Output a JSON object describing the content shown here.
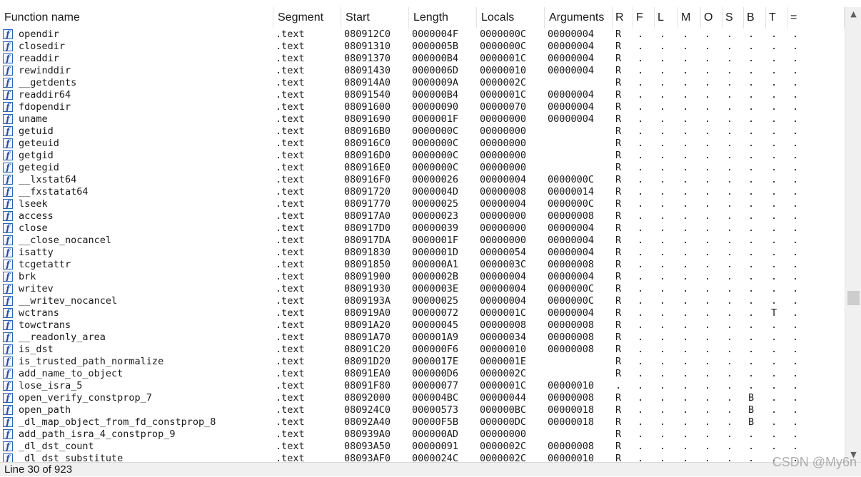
{
  "columns": [
    "Function name",
    "Segment",
    "Start",
    "Length",
    "Locals",
    "Arguments",
    "R",
    "F",
    "L",
    "M",
    "O",
    "S",
    "B",
    "T",
    "="
  ],
  "rows": [
    {
      "name": "opendir",
      "seg": ".text",
      "start": "080912C0",
      "len": "0000004F",
      "locals": "0000000C",
      "args": "00000004",
      "r": "R",
      "f": ".",
      "l": ".",
      "m": ".",
      "o": ".",
      "s": ".",
      "b": ".",
      "t": ".",
      "eq": "."
    },
    {
      "name": "closedir",
      "seg": ".text",
      "start": "08091310",
      "len": "0000005B",
      "locals": "0000000C",
      "args": "00000004",
      "r": "R",
      "f": ".",
      "l": ".",
      "m": ".",
      "o": ".",
      "s": ".",
      "b": ".",
      "t": ".",
      "eq": "."
    },
    {
      "name": "readdir",
      "seg": ".text",
      "start": "08091370",
      "len": "000000B4",
      "locals": "0000001C",
      "args": "00000004",
      "r": "R",
      "f": ".",
      "l": ".",
      "m": ".",
      "o": ".",
      "s": ".",
      "b": ".",
      "t": ".",
      "eq": "."
    },
    {
      "name": "rewinddir",
      "seg": ".text",
      "start": "08091430",
      "len": "0000006D",
      "locals": "00000010",
      "args": "00000004",
      "r": "R",
      "f": ".",
      "l": ".",
      "m": ".",
      "o": ".",
      "s": ".",
      "b": ".",
      "t": ".",
      "eq": "."
    },
    {
      "name": "__getdents",
      "seg": ".text",
      "start": "080914A0",
      "len": "0000009A",
      "locals": "0000002C",
      "args": "",
      "r": "R",
      "f": ".",
      "l": ".",
      "m": ".",
      "o": ".",
      "s": ".",
      "b": ".",
      "t": ".",
      "eq": "."
    },
    {
      "name": "readdir64",
      "seg": ".text",
      "start": "08091540",
      "len": "000000B4",
      "locals": "0000001C",
      "args": "00000004",
      "r": "R",
      "f": ".",
      "l": ".",
      "m": ".",
      "o": ".",
      "s": ".",
      "b": ".",
      "t": ".",
      "eq": "."
    },
    {
      "name": "fdopendir",
      "seg": ".text",
      "start": "08091600",
      "len": "00000090",
      "locals": "00000070",
      "args": "00000004",
      "r": "R",
      "f": ".",
      "l": ".",
      "m": ".",
      "o": ".",
      "s": ".",
      "b": ".",
      "t": ".",
      "eq": "."
    },
    {
      "name": "uname",
      "seg": ".text",
      "start": "08091690",
      "len": "0000001F",
      "locals": "00000000",
      "args": "00000004",
      "r": "R",
      "f": ".",
      "l": ".",
      "m": ".",
      "o": ".",
      "s": ".",
      "b": ".",
      "t": ".",
      "eq": "."
    },
    {
      "name": "getuid",
      "seg": ".text",
      "start": "080916B0",
      "len": "0000000C",
      "locals": "00000000",
      "args": "",
      "r": "R",
      "f": ".",
      "l": ".",
      "m": ".",
      "o": ".",
      "s": ".",
      "b": ".",
      "t": ".",
      "eq": "."
    },
    {
      "name": "geteuid",
      "seg": ".text",
      "start": "080916C0",
      "len": "0000000C",
      "locals": "00000000",
      "args": "",
      "r": "R",
      "f": ".",
      "l": ".",
      "m": ".",
      "o": ".",
      "s": ".",
      "b": ".",
      "t": ".",
      "eq": "."
    },
    {
      "name": "getgid",
      "seg": ".text",
      "start": "080916D0",
      "len": "0000000C",
      "locals": "00000000",
      "args": "",
      "r": "R",
      "f": ".",
      "l": ".",
      "m": ".",
      "o": ".",
      "s": ".",
      "b": ".",
      "t": ".",
      "eq": "."
    },
    {
      "name": "getegid",
      "seg": ".text",
      "start": "080916E0",
      "len": "0000000C",
      "locals": "00000000",
      "args": "",
      "r": "R",
      "f": ".",
      "l": ".",
      "m": ".",
      "o": ".",
      "s": ".",
      "b": ".",
      "t": ".",
      "eq": "."
    },
    {
      "name": "__lxstat64",
      "seg": ".text",
      "start": "080916F0",
      "len": "00000026",
      "locals": "00000004",
      "args": "0000000C",
      "r": "R",
      "f": ".",
      "l": ".",
      "m": ".",
      "o": ".",
      "s": ".",
      "b": ".",
      "t": ".",
      "eq": "."
    },
    {
      "name": "__fxstatat64",
      "seg": ".text",
      "start": "08091720",
      "len": "0000004D",
      "locals": "00000008",
      "args": "00000014",
      "r": "R",
      "f": ".",
      "l": ".",
      "m": ".",
      "o": ".",
      "s": ".",
      "b": ".",
      "t": ".",
      "eq": "."
    },
    {
      "name": "lseek",
      "seg": ".text",
      "start": "08091770",
      "len": "00000025",
      "locals": "00000004",
      "args": "0000000C",
      "r": "R",
      "f": ".",
      "l": ".",
      "m": ".",
      "o": ".",
      "s": ".",
      "b": ".",
      "t": ".",
      "eq": "."
    },
    {
      "name": "access",
      "seg": ".text",
      "start": "080917A0",
      "len": "00000023",
      "locals": "00000000",
      "args": "00000008",
      "r": "R",
      "f": ".",
      "l": ".",
      "m": ".",
      "o": ".",
      "s": ".",
      "b": ".",
      "t": ".",
      "eq": "."
    },
    {
      "name": "close",
      "seg": ".text",
      "start": "080917D0",
      "len": "00000039",
      "locals": "00000000",
      "args": "00000004",
      "r": "R",
      "f": ".",
      "l": ".",
      "m": ".",
      "o": ".",
      "s": ".",
      "b": ".",
      "t": ".",
      "eq": "."
    },
    {
      "name": "__close_nocancel",
      "seg": ".text",
      "start": "080917DA",
      "len": "0000001F",
      "locals": "00000000",
      "args": "00000004",
      "r": "R",
      "f": ".",
      "l": ".",
      "m": ".",
      "o": ".",
      "s": ".",
      "b": ".",
      "t": ".",
      "eq": "."
    },
    {
      "name": "isatty",
      "seg": ".text",
      "start": "08091830",
      "len": "0000001D",
      "locals": "00000054",
      "args": "00000004",
      "r": "R",
      "f": ".",
      "l": ".",
      "m": ".",
      "o": ".",
      "s": ".",
      "b": ".",
      "t": ".",
      "eq": "."
    },
    {
      "name": "tcgetattr",
      "seg": ".text",
      "start": "08091850",
      "len": "000000A1",
      "locals": "0000003C",
      "args": "00000008",
      "r": "R",
      "f": ".",
      "l": ".",
      "m": ".",
      "o": ".",
      "s": ".",
      "b": ".",
      "t": ".",
      "eq": "."
    },
    {
      "name": "brk",
      "seg": ".text",
      "start": "08091900",
      "len": "0000002B",
      "locals": "00000004",
      "args": "00000004",
      "r": "R",
      "f": ".",
      "l": ".",
      "m": ".",
      "o": ".",
      "s": ".",
      "b": ".",
      "t": ".",
      "eq": "."
    },
    {
      "name": "writev",
      "seg": ".text",
      "start": "08091930",
      "len": "0000003E",
      "locals": "00000004",
      "args": "0000000C",
      "r": "R",
      "f": ".",
      "l": ".",
      "m": ".",
      "o": ".",
      "s": ".",
      "b": ".",
      "t": ".",
      "eq": "."
    },
    {
      "name": "__writev_nocancel",
      "seg": ".text",
      "start": "0809193A",
      "len": "00000025",
      "locals": "00000004",
      "args": "0000000C",
      "r": "R",
      "f": ".",
      "l": ".",
      "m": ".",
      "o": ".",
      "s": ".",
      "b": ".",
      "t": ".",
      "eq": "."
    },
    {
      "name": "wctrans",
      "seg": ".text",
      "start": "080919A0",
      "len": "00000072",
      "locals": "0000001C",
      "args": "00000004",
      "r": "R",
      "f": ".",
      "l": ".",
      "m": ".",
      "o": ".",
      "s": ".",
      "b": ".",
      "t": "T",
      "eq": "."
    },
    {
      "name": "towctrans",
      "seg": ".text",
      "start": "08091A20",
      "len": "00000045",
      "locals": "00000008",
      "args": "00000008",
      "r": "R",
      "f": ".",
      "l": ".",
      "m": ".",
      "o": ".",
      "s": ".",
      "b": ".",
      "t": ".",
      "eq": "."
    },
    {
      "name": "__readonly_area",
      "seg": ".text",
      "start": "08091A70",
      "len": "000001A9",
      "locals": "00000034",
      "args": "00000008",
      "r": "R",
      "f": ".",
      "l": ".",
      "m": ".",
      "o": ".",
      "s": ".",
      "b": ".",
      "t": ".",
      "eq": "."
    },
    {
      "name": "is_dst",
      "seg": ".text",
      "start": "08091C20",
      "len": "000000F6",
      "locals": "00000010",
      "args": "00000008",
      "r": "R",
      "f": ".",
      "l": ".",
      "m": ".",
      "o": ".",
      "s": ".",
      "b": ".",
      "t": ".",
      "eq": "."
    },
    {
      "name": "is_trusted_path_normalize",
      "seg": ".text",
      "start": "08091D20",
      "len": "0000017E",
      "locals": "0000001E",
      "args": "",
      "r": "R",
      "f": ".",
      "l": ".",
      "m": ".",
      "o": ".",
      "s": ".",
      "b": ".",
      "t": ".",
      "eq": "."
    },
    {
      "name": "add_name_to_object",
      "seg": ".text",
      "start": "08091EA0",
      "len": "000000D6",
      "locals": "0000002C",
      "args": "",
      "r": "R",
      "f": ".",
      "l": ".",
      "m": ".",
      "o": ".",
      "s": ".",
      "b": ".",
      "t": ".",
      "eq": "."
    },
    {
      "name": "lose_isra_5",
      "seg": ".text",
      "start": "08091F80",
      "len": "00000077",
      "locals": "0000001C",
      "args": "00000010",
      "r": ".",
      "f": ".",
      "l": ".",
      "m": ".",
      "o": ".",
      "s": ".",
      "b": ".",
      "t": ".",
      "eq": "."
    },
    {
      "name": "open_verify_constprop_7",
      "seg": ".text",
      "start": "08092000",
      "len": "000004BC",
      "locals": "00000044",
      "args": "00000008",
      "r": "R",
      "f": ".",
      "l": ".",
      "m": ".",
      "o": ".",
      "s": ".",
      "b": "B",
      "t": ".",
      "eq": "."
    },
    {
      "name": "open_path",
      "seg": ".text",
      "start": "080924C0",
      "len": "00000573",
      "locals": "000000BC",
      "args": "00000018",
      "r": "R",
      "f": ".",
      "l": ".",
      "m": ".",
      "o": ".",
      "s": ".",
      "b": "B",
      "t": ".",
      "eq": "."
    },
    {
      "name": "_dl_map_object_from_fd_constprop_8",
      "seg": ".text",
      "start": "08092A40",
      "len": "00000F5B",
      "locals": "000000DC",
      "args": "00000018",
      "r": "R",
      "f": ".",
      "l": ".",
      "m": ".",
      "o": ".",
      "s": ".",
      "b": "B",
      "t": ".",
      "eq": "."
    },
    {
      "name": "add_path_isra_4_constprop_9",
      "seg": ".text",
      "start": "080939A0",
      "len": "000000AD",
      "locals": "00000000",
      "args": "",
      "r": "R",
      "f": ".",
      "l": ".",
      "m": ".",
      "o": ".",
      "s": ".",
      "b": ".",
      "t": ".",
      "eq": "."
    },
    {
      "name": "_dl_dst_count",
      "seg": ".text",
      "start": "08093A50",
      "len": "00000091",
      "locals": "0000002C",
      "args": "00000008",
      "r": "R",
      "f": ".",
      "l": ".",
      "m": ".",
      "o": ".",
      "s": ".",
      "b": ".",
      "t": ".",
      "eq": "."
    },
    {
      "name": "_dl_dst_substitute",
      "seg": ".text",
      "start": "08093AF0",
      "len": "0000024C",
      "locals": "0000002C",
      "args": "00000010",
      "r": "R",
      "f": ".",
      "l": ".",
      "m": ".",
      "o": ".",
      "s": ".",
      "b": ".",
      "t": ".",
      "eq": "."
    }
  ],
  "status": "Line 30 of 923",
  "watermark": "CSDN @My6n",
  "icons": {
    "function": "function-icon",
    "scroll_up": "scroll-up-arrow-icon",
    "scroll_down": "scroll-down-arrow-icon"
  },
  "colors": {
    "icon_border": "#2a64b8",
    "status_bg": "#f0f0f0"
  }
}
